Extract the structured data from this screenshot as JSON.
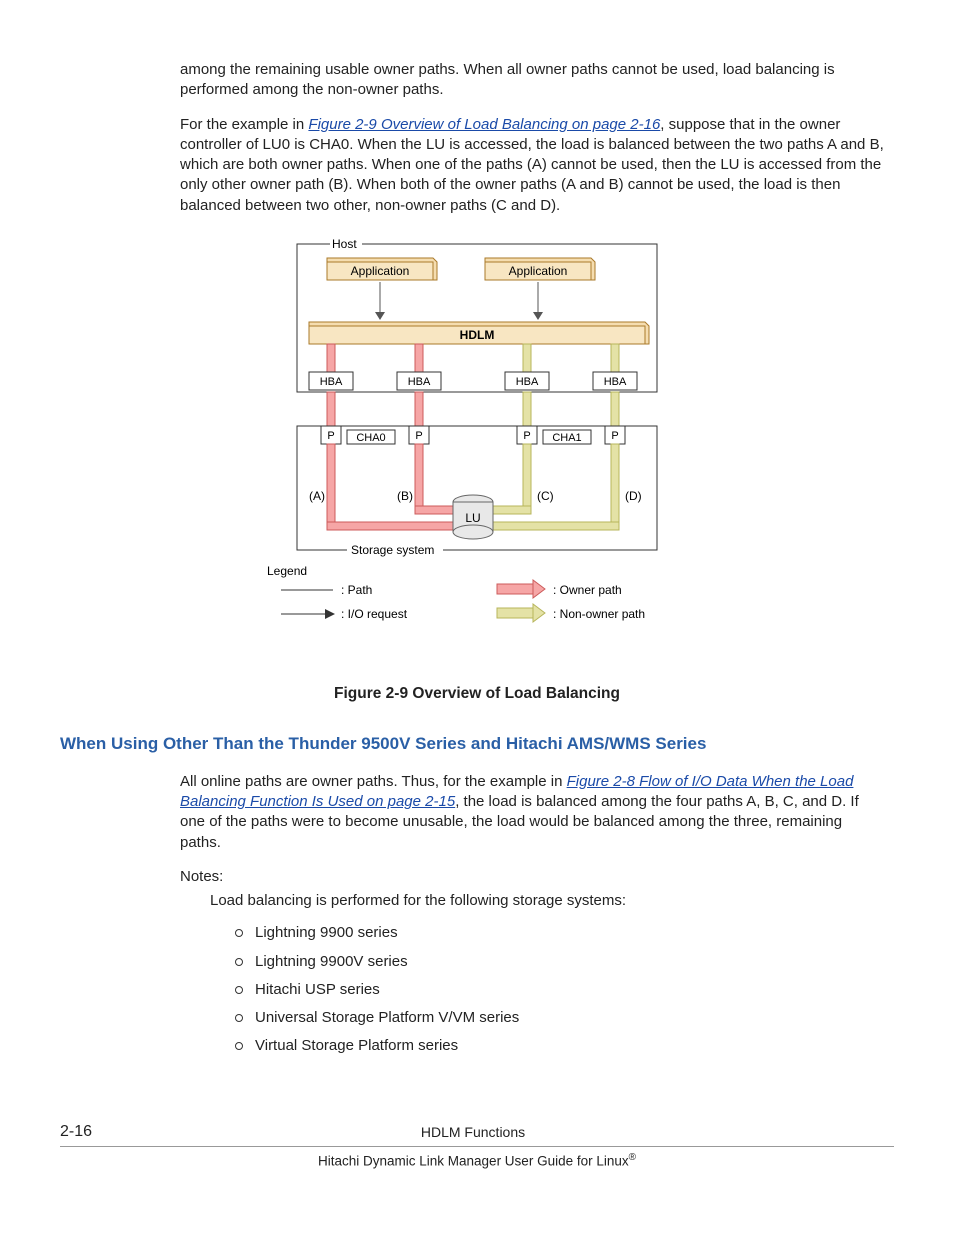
{
  "para1": "among the remaining usable owner paths. When all owner paths cannot be used, load balancing is performed among the non-owner paths.",
  "para2_a": "For the example in ",
  "para2_link": "Figure 2-9 Overview of Load Balancing on page 2-16",
  "para2_b": ", suppose that in the owner controller of LU0 is CHA0. When the LU is accessed, the load is balanced between the two paths A and B, which are both owner paths. When one of the paths (A) cannot be used, then the LU is accessed from the only other owner path (B). When both of the owner paths (A and B) cannot be used, the load is then balanced between two other, non-owner paths (C and D).",
  "diagram": {
    "host": "Host",
    "application": "Application",
    "hdlm": "HDLM",
    "hba": "HBA",
    "p": "P",
    "cha0": "CHA0",
    "cha1": "CHA1",
    "a": "(A)",
    "b": "(B)",
    "c": "(C)",
    "d": "(D)",
    "lu": "LU",
    "storage": "Storage system",
    "legend": "Legend",
    "path": ": Path",
    "io": ": I/O request",
    "owner": ": Owner path",
    "nonowner": ": Non-owner path"
  },
  "figure_caption": "Figure 2-9 Overview of Load Balancing",
  "section_heading": "When Using Other Than the Thunder 9500V Series and Hitachi AMS/WMS Series",
  "sec_para_a": "All online paths are owner paths. Thus, for the example in ",
  "sec_link": "Figure 2-8 Flow of I/O Data When the Load Balancing Function Is Used on page 2-15",
  "sec_para_b": ", the load is balanced among the four paths A, B, C, and D. If one of the paths were to become unusable, the load would be balanced among the three, remaining paths.",
  "notes_label": "Notes:",
  "notes_intro": "Load balancing is performed for the following storage systems:",
  "list": [
    "Lightning 9900 series",
    "Lightning 9900V series",
    "Hitachi USP series",
    "Universal Storage Platform V/VM series",
    "Virtual Storage Platform series"
  ],
  "footer": {
    "pagenum": "2-16",
    "chapter": "HDLM Functions",
    "doc": "Hitachi Dynamic Link Manager User Guide for Linux"
  }
}
